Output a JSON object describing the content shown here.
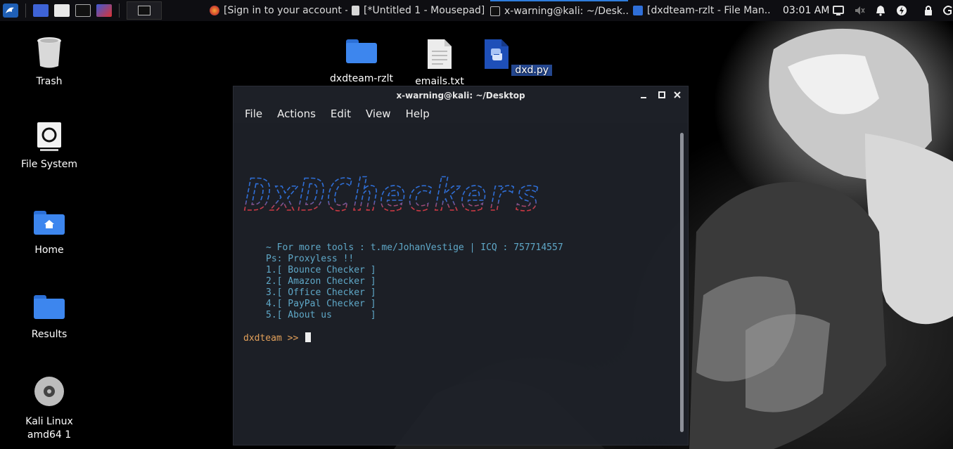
{
  "panel": {
    "tasks": [
      {
        "label": "[Sign in to your account - ...",
        "icon": "firefox-icon"
      },
      {
        "label": "[*Untitled 1 - Mousepad]",
        "icon": "mousepad-icon"
      },
      {
        "label": "x-warning@kali: ~/Desk...",
        "icon": "terminal-icon"
      },
      {
        "label": "[dxdteam-rzlt - File Man...",
        "icon": "file-manager-icon"
      }
    ],
    "clock": "03:01 AM"
  },
  "desktop": {
    "left_icons": [
      {
        "label": "Trash",
        "icon": "trash-icon"
      },
      {
        "label": "File System",
        "icon": "drive-icon"
      },
      {
        "label": "Home",
        "icon": "home-folder-icon"
      },
      {
        "label": "Results",
        "icon": "folder-icon"
      },
      {
        "label": "Kali Linux amd64 1",
        "icon": "disc-icon"
      }
    ],
    "top_icons": [
      {
        "label": "dxdteam-rzlt",
        "icon": "folder-icon"
      },
      {
        "label": "emails.txt",
        "icon": "text-file-icon"
      },
      {
        "label": "dxd.py",
        "icon": "python-file-icon"
      }
    ]
  },
  "terminal": {
    "title": "x-warning@kali: ~/Desktop",
    "menu": [
      "File",
      "Actions",
      "Edit",
      "View",
      "Help"
    ],
    "banner_text": "DxDCheckers",
    "info": "~ For more tools : t.me/JohanVestige | ICQ : 757714557",
    "note": "Ps: Proxyless !!",
    "options": [
      "1.[ Bounce Checker ]",
      "2.[ Amazon Checker ]",
      "3.[ Office Checker ]",
      "4.[ PayPal Checker ]",
      "5.[ About us       ]"
    ],
    "prompt": "dxdteam >> "
  },
  "colors": {
    "banner_blue": "#2f6fd8",
    "banner_red": "#e03030",
    "prompt": "#e2a05a",
    "text": "#5fa8c8"
  }
}
